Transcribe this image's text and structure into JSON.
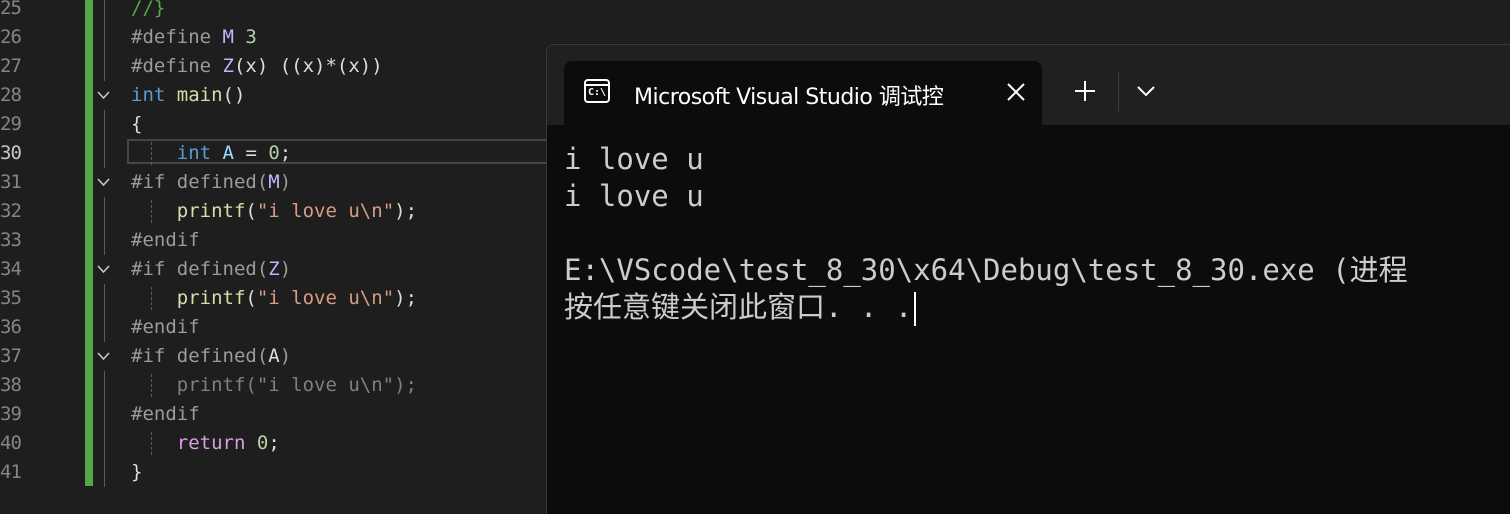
{
  "editor": {
    "lines": [
      {
        "num": "25",
        "tokens": [
          {
            "t": "//}",
            "c": "t-cmt"
          }
        ]
      },
      {
        "num": "26",
        "tokens": [
          {
            "t": "#define ",
            "c": "t-pre"
          },
          {
            "t": "M",
            "c": "t-mac"
          },
          {
            "t": " ",
            "c": "t-plain"
          },
          {
            "t": "3",
            "c": "t-num"
          }
        ]
      },
      {
        "num": "27",
        "tokens": [
          {
            "t": "#define ",
            "c": "t-pre"
          },
          {
            "t": "Z",
            "c": "t-mac"
          },
          {
            "t": "(x) ((x)*(x))",
            "c": "t-plain"
          }
        ]
      },
      {
        "num": "28",
        "tokens": [
          {
            "t": "int",
            "c": "t-kw"
          },
          {
            "t": " ",
            "c": "t-plain"
          },
          {
            "t": "main",
            "c": "t-fn"
          },
          {
            "t": "()",
            "c": "t-plain"
          }
        ]
      },
      {
        "num": "29",
        "tokens": [
          {
            "t": "{",
            "c": "t-plain"
          }
        ]
      },
      {
        "num": "30",
        "tokens": [
          {
            "t": "    ",
            "c": "t-plain"
          },
          {
            "t": "int",
            "c": "t-kw"
          },
          {
            "t": " ",
            "c": "t-plain"
          },
          {
            "t": "A",
            "c": "t-var"
          },
          {
            "t": " = ",
            "c": "t-plain"
          },
          {
            "t": "0",
            "c": "t-num"
          },
          {
            "t": ";",
            "c": "t-plain"
          }
        ]
      },
      {
        "num": "31",
        "tokens": [
          {
            "t": "#if defined(",
            "c": "t-pre"
          },
          {
            "t": "M",
            "c": "t-mac"
          },
          {
            "t": ")",
            "c": "t-pre"
          }
        ]
      },
      {
        "num": "32",
        "tokens": [
          {
            "t": "    ",
            "c": "t-plain"
          },
          {
            "t": "printf",
            "c": "t-fn"
          },
          {
            "t": "(",
            "c": "t-plain"
          },
          {
            "t": "\"i love u\\n\"",
            "c": "t-str"
          },
          {
            "t": ");",
            "c": "t-plain"
          }
        ]
      },
      {
        "num": "33",
        "tokens": [
          {
            "t": "#endif",
            "c": "t-pre"
          }
        ]
      },
      {
        "num": "34",
        "tokens": [
          {
            "t": "#if defined(",
            "c": "t-pre"
          },
          {
            "t": "Z",
            "c": "t-mac"
          },
          {
            "t": ")",
            "c": "t-pre"
          }
        ]
      },
      {
        "num": "35",
        "tokens": [
          {
            "t": "    ",
            "c": "t-plain"
          },
          {
            "t": "printf",
            "c": "t-fn"
          },
          {
            "t": "(",
            "c": "t-plain"
          },
          {
            "t": "\"i love u\\n\"",
            "c": "t-str"
          },
          {
            "t": ");",
            "c": "t-plain"
          }
        ]
      },
      {
        "num": "36",
        "tokens": [
          {
            "t": "#endif",
            "c": "t-pre"
          }
        ]
      },
      {
        "num": "37",
        "tokens": [
          {
            "t": "#if defined(",
            "c": "t-pre"
          },
          {
            "t": "A",
            "c": "t-plain"
          },
          {
            "t": ")",
            "c": "t-pre"
          }
        ]
      },
      {
        "num": "38",
        "tokens": [
          {
            "t": "    printf(\"i love u\\n\");",
            "c": "t-dim"
          }
        ]
      },
      {
        "num": "39",
        "tokens": [
          {
            "t": "#endif",
            "c": "t-pre"
          }
        ]
      },
      {
        "num": "40",
        "tokens": [
          {
            "t": "    ",
            "c": "t-plain"
          },
          {
            "t": "return",
            "c": "t-kw2"
          },
          {
            "t": " ",
            "c": "t-plain"
          },
          {
            "t": "0",
            "c": "t-num"
          },
          {
            "t": ";",
            "c": "t-plain"
          }
        ]
      },
      {
        "num": "41",
        "tokens": [
          {
            "t": "}",
            "c": "t-plain"
          }
        ]
      }
    ],
    "active_line": "30",
    "fold_lines": [
      "28",
      "31",
      "34",
      "37"
    ],
    "colors": {
      "change_bar": "#57a64a",
      "background": "#1e1e1e"
    }
  },
  "terminal": {
    "tab_title": "Microsoft Visual Studio 调试控",
    "tab_icon": "console-icon",
    "icon_text": "C:\\",
    "close_icon": "close-icon",
    "new_tab_icon": "plus-icon",
    "dropdown_icon": "chevron-down-icon",
    "output_lines": [
      "i love u",
      "i love u",
      "",
      "E:\\VScode\\test_8_30\\x64\\Debug\\test_8_30.exe (进程",
      "按任意键关闭此窗口. . ."
    ],
    "colors": {
      "background": "#0c0c0c",
      "tabbar": "#202020",
      "text": "#cccccc"
    }
  }
}
